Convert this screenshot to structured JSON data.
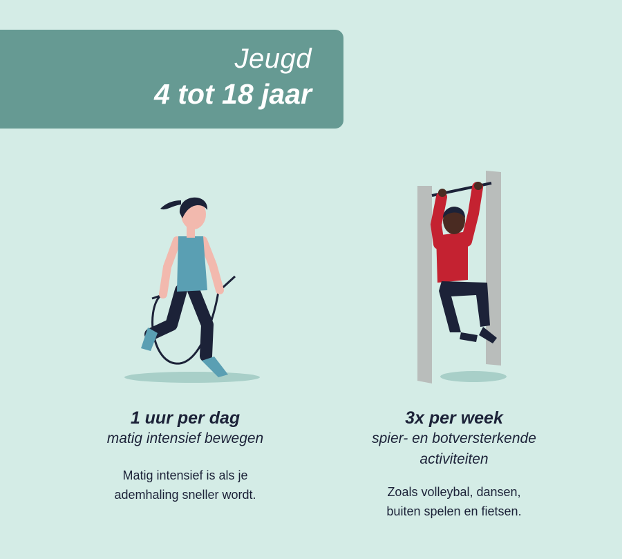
{
  "banner": {
    "title": "Jeugd",
    "age_range": "4 tot 18 jaar"
  },
  "left": {
    "headline": "1 uur per dag",
    "subline": "matig intensief bewegen",
    "body_line1": "Matig intensief is als je",
    "body_line2": "ademhaling sneller wordt.",
    "illustration": "girl-skipping-rope"
  },
  "right": {
    "headline": "3x per week",
    "subline_line1": "spier- en botversterkende",
    "subline_line2": "activiteiten",
    "body_line1": "Zoals volleybal, dansen,",
    "body_line2": "buiten spelen en fietsen.",
    "illustration": "child-hanging-from-bar"
  },
  "colors": {
    "background": "#d4ece6",
    "banner": "#669a93",
    "text": "#1c2238",
    "shadow": "#a8cfc8",
    "accent_teal": "#5a9fb3",
    "accent_red": "#c42231"
  }
}
